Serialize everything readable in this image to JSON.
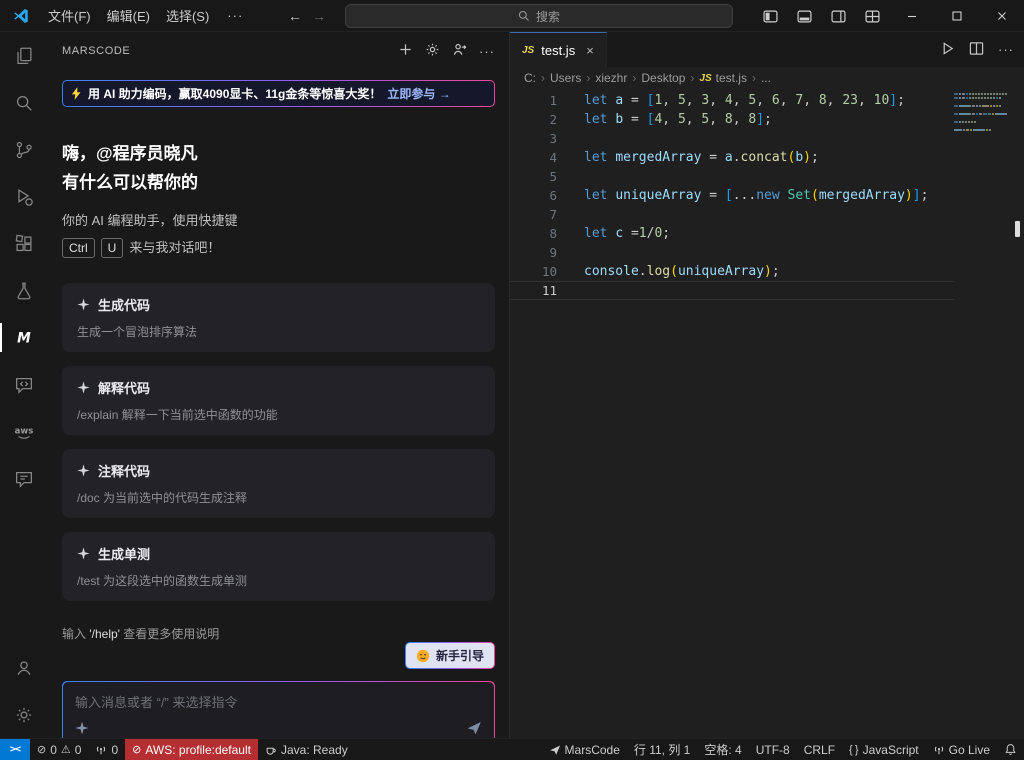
{
  "window": {
    "menus": [
      "文件(F)",
      "编辑(E)",
      "选择(S)"
    ],
    "more_label": "···",
    "search_placeholder": "搜索"
  },
  "sidebar": {
    "title": "MARSCODE",
    "banner": {
      "text": "用 AI 助力编码，赢取4090显卡、11g金条等惊喜大奖！",
      "cta": "立即参与 →"
    },
    "greeting": {
      "line1": "嗨，@程序员晓凡",
      "line2": "有什么可以帮你的"
    },
    "intro": {
      "line1": "你的 AI 编程助手，使用快捷键",
      "keys": [
        "Ctrl",
        "U"
      ],
      "line2": "来与我对话吧！"
    },
    "cards": [
      {
        "title": "生成代码",
        "desc": "生成一个冒泡排序算法"
      },
      {
        "title": "解释代码",
        "desc": "/explain 解释一下当前选中函数的功能"
      },
      {
        "title": "注释代码",
        "desc": "/doc 为当前选中的代码生成注释"
      },
      {
        "title": "生成单测",
        "desc": "/test 为这段选中的函数生成单测"
      }
    ],
    "help": {
      "prefix": "输入 ",
      "command": "'/help'",
      "suffix": " 查看更多使用说明"
    },
    "guide_button": "新手引导",
    "input_placeholder": "输入消息或者 “/” 来选择指令"
  },
  "editor": {
    "tab": {
      "label": "test.js",
      "icon": "JS"
    },
    "breadcrumbs": [
      {
        "label": "C:"
      },
      {
        "label": "Users"
      },
      {
        "label": "xiezhr"
      },
      {
        "label": "Desktop"
      },
      {
        "label": "test.js",
        "icon": "js"
      },
      {
        "label": "..."
      }
    ],
    "code": {
      "active_line": 11,
      "lines": [
        {
          "n": 1,
          "tokens": [
            [
              "let ",
              "kw"
            ],
            [
              "a",
              "v"
            ],
            [
              " = ",
              "p"
            ],
            [
              "[",
              "b"
            ],
            [
              "1",
              "n"
            ],
            [
              ", ",
              "p"
            ],
            [
              "5",
              "n"
            ],
            [
              ", ",
              "p"
            ],
            [
              "3",
              "n"
            ],
            [
              ", ",
              "p"
            ],
            [
              "4",
              "n"
            ],
            [
              ", ",
              "p"
            ],
            [
              "5",
              "n"
            ],
            [
              ", ",
              "p"
            ],
            [
              "6",
              "n"
            ],
            [
              ", ",
              "p"
            ],
            [
              "7",
              "n"
            ],
            [
              ", ",
              "p"
            ],
            [
              "8",
              "n"
            ],
            [
              ", ",
              "p"
            ],
            [
              "23",
              "n"
            ],
            [
              ", ",
              "p"
            ],
            [
              "10",
              "n"
            ],
            [
              "]",
              "b"
            ],
            [
              ";",
              "p"
            ]
          ]
        },
        {
          "n": 2,
          "tokens": [
            [
              "let ",
              "kw"
            ],
            [
              "b",
              "v"
            ],
            [
              " = ",
              "p"
            ],
            [
              "[",
              "b"
            ],
            [
              "4",
              "n"
            ],
            [
              ", ",
              "p"
            ],
            [
              "5",
              "n"
            ],
            [
              ", ",
              "p"
            ],
            [
              "5",
              "n"
            ],
            [
              ", ",
              "p"
            ],
            [
              "8",
              "n"
            ],
            [
              ", ",
              "p"
            ],
            [
              "8",
              "n"
            ],
            [
              "]",
              "b"
            ],
            [
              ";",
              "p"
            ]
          ]
        },
        {
          "n": 3,
          "tokens": []
        },
        {
          "n": 4,
          "tokens": [
            [
              "let ",
              "kw"
            ],
            [
              "mergedArray",
              "v"
            ],
            [
              " = ",
              "p"
            ],
            [
              "a",
              "v"
            ],
            [
              ".",
              "p"
            ],
            [
              "concat",
              "f"
            ],
            [
              "(",
              "b2"
            ],
            [
              "b",
              "v"
            ],
            [
              ")",
              "b2"
            ],
            [
              ";",
              "p"
            ]
          ]
        },
        {
          "n": 5,
          "tokens": []
        },
        {
          "n": 6,
          "tokens": [
            [
              "let ",
              "kw"
            ],
            [
              "uniqueArray",
              "v"
            ],
            [
              " = ",
              "p"
            ],
            [
              "[",
              "b"
            ],
            [
              "...",
              "p"
            ],
            [
              "new ",
              "kw"
            ],
            [
              "Set",
              "c"
            ],
            [
              "(",
              "b2"
            ],
            [
              "mergedArray",
              "v"
            ],
            [
              ")",
              "b2"
            ],
            [
              "]",
              "b"
            ],
            [
              ";",
              "p"
            ]
          ]
        },
        {
          "n": 7,
          "tokens": []
        },
        {
          "n": 8,
          "tokens": [
            [
              "let ",
              "kw"
            ],
            [
              "c",
              "v"
            ],
            [
              " =",
              "p"
            ],
            [
              "1",
              "n"
            ],
            [
              "/",
              "p"
            ],
            [
              "0",
              "n"
            ],
            [
              ";",
              "p"
            ]
          ]
        },
        {
          "n": 9,
          "tokens": []
        },
        {
          "n": 10,
          "tokens": [
            [
              "console",
              "v"
            ],
            [
              ".",
              "p"
            ],
            [
              "log",
              "f"
            ],
            [
              "(",
              "b2"
            ],
            [
              "uniqueArray",
              "v"
            ],
            [
              ")",
              "b2"
            ],
            [
              ";",
              "p"
            ]
          ]
        },
        {
          "n": 11,
          "tokens": []
        }
      ]
    }
  },
  "status_bar": {
    "errors": "0",
    "warnings": "0",
    "broadcast": "0",
    "aws": "AWS: profile:default",
    "java": "Java: Ready",
    "marscode": "MarsCode",
    "cursor": "行 11, 列 1",
    "spaces": "空格: 4",
    "encoding": "UTF-8",
    "eol": "CRLF",
    "language": "JavaScript",
    "golive": "Go Live"
  }
}
